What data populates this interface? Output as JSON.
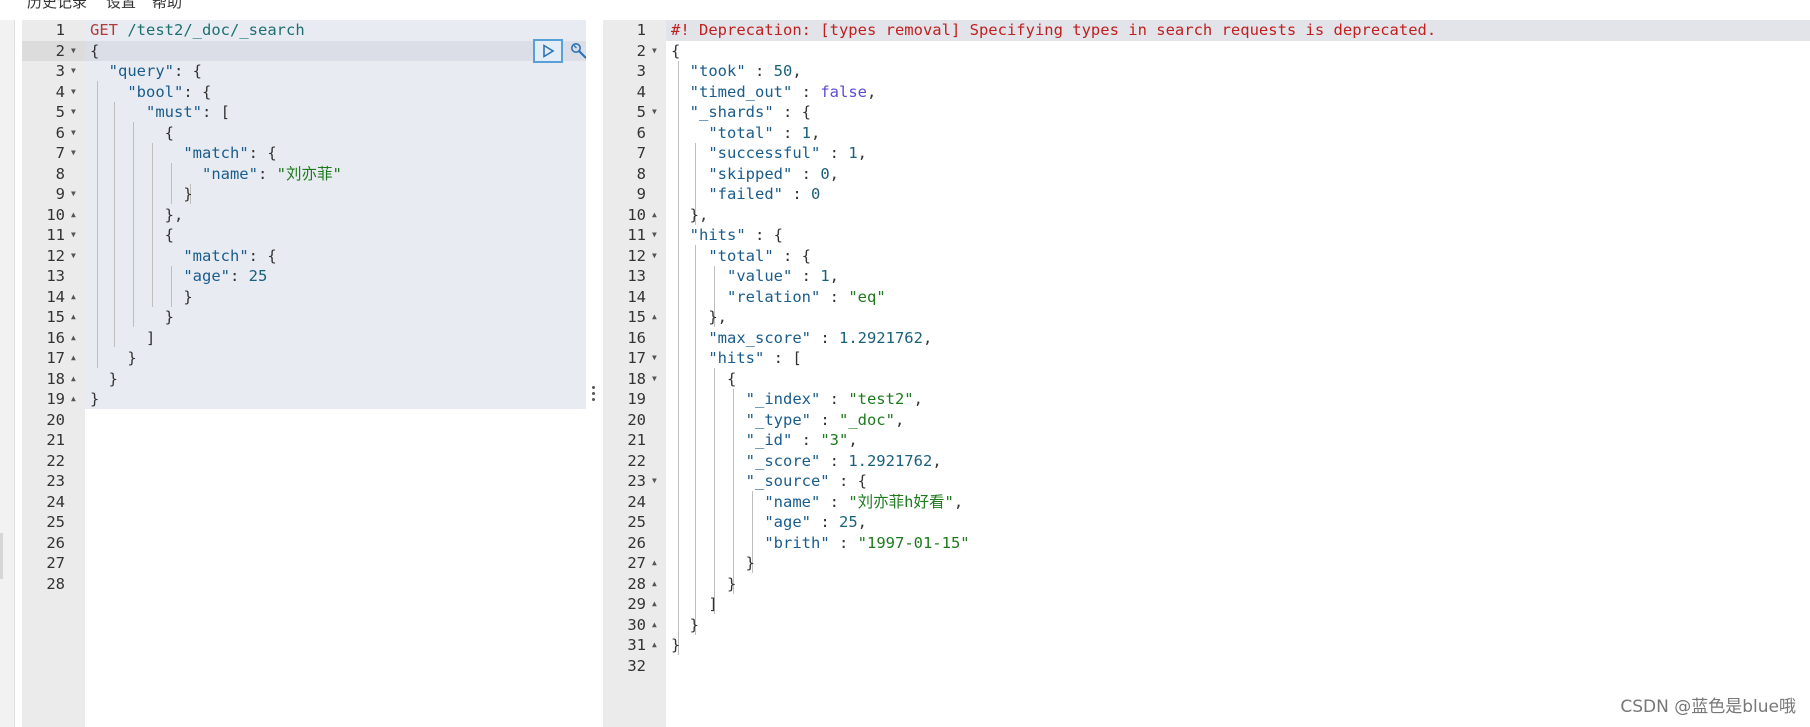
{
  "menu": {
    "items": [
      "历史记录",
      "设置",
      "帮助"
    ]
  },
  "request": {
    "line_numbers": [
      "1",
      "2",
      "3",
      "4",
      "5",
      "6",
      "7",
      "8",
      "9",
      "10",
      "11",
      "12",
      "13",
      "14",
      "15",
      "16",
      "17",
      "18",
      "19",
      "20",
      "21",
      "22",
      "23",
      "24",
      "25",
      "26",
      "27",
      "28"
    ],
    "method": "GET",
    "path": "/test2/_doc/_search",
    "body": {
      "brace_open": "{",
      "k_query": "\"query\"",
      "k_bool": "\"bool\"",
      "k_must": "\"must\"",
      "k_match": "\"match\"",
      "k_name": "\"name\"",
      "v_name": "\"刘亦菲\"",
      "k_age": "\"age\"",
      "v_age": "25",
      "brace_close": "}"
    }
  },
  "response": {
    "line_numbers": [
      "1",
      "2",
      "3",
      "4",
      "5",
      "6",
      "7",
      "8",
      "9",
      "10",
      "11",
      "12",
      "13",
      "14",
      "15",
      "16",
      "17",
      "18",
      "19",
      "20",
      "21",
      "22",
      "23",
      "24",
      "25",
      "26",
      "27",
      "28",
      "29",
      "30",
      "31",
      "32"
    ],
    "warning": "#! Deprecation: [types removal] Specifying types in search requests is deprecated.",
    "keys": {
      "took": "\"took\"",
      "timed_out": "\"timed_out\"",
      "shards": "\"_shards\"",
      "total": "\"total\"",
      "successful": "\"successful\"",
      "skipped": "\"skipped\"",
      "failed": "\"failed\"",
      "hits": "\"hits\"",
      "value": "\"value\"",
      "relation": "\"relation\"",
      "max_score": "\"max_score\"",
      "index": "\"_index\"",
      "type": "\"_type\"",
      "id": "\"_id\"",
      "score": "\"_score\"",
      "source": "\"_source\"",
      "name": "\"name\"",
      "age": "\"age\"",
      "brith": "\"brith\""
    },
    "values": {
      "took": "50",
      "timed_out": "false",
      "total": "1",
      "successful": "1",
      "skipped": "0",
      "failed": "0",
      "value": "1",
      "relation": "\"eq\"",
      "max_score": "1.2921762",
      "index": "\"test2\"",
      "type": "\"_doc\"",
      "id": "\"3\"",
      "score": "1.2921762",
      "name": "\"刘亦菲h好看\"",
      "age": "25",
      "brith": "\"1997-01-15\""
    }
  },
  "watermark": "CSDN @蓝色是blue哦",
  "icons": {
    "run": "play-icon",
    "settings": "wrench-icon",
    "resize": "vertical-dots-icon"
  },
  "colors": {
    "keyword": "#1a5c8c",
    "string": "#1e7a1e",
    "number": "#19607a",
    "boolean": "#5b4cd6",
    "warning": "#c02020"
  }
}
